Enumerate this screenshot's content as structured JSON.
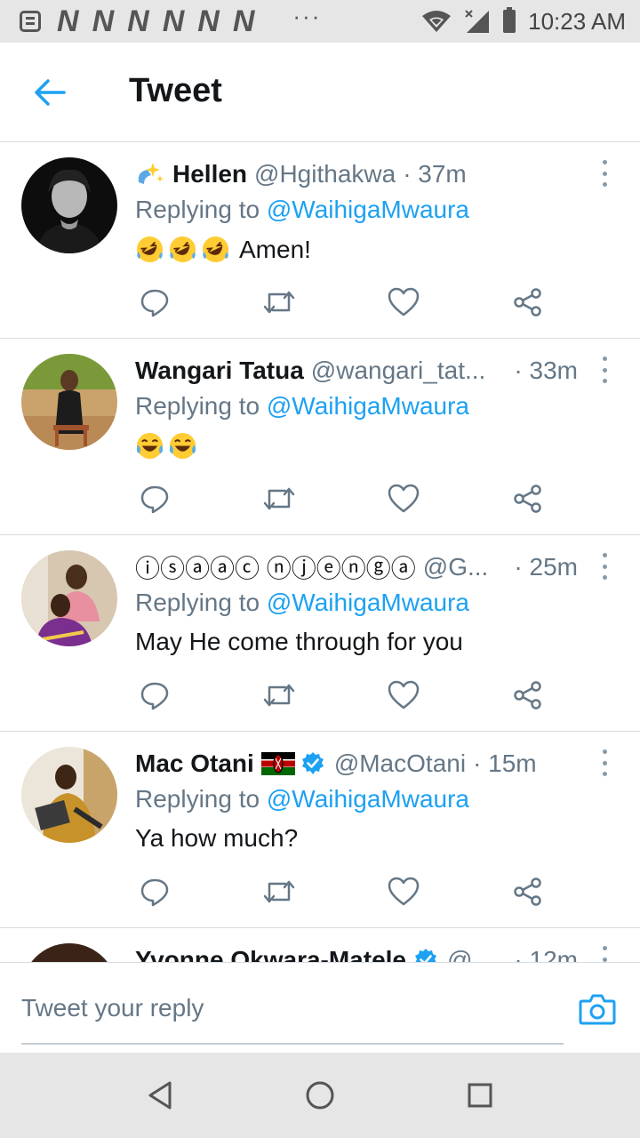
{
  "status_bar": {
    "notification_icons": [
      "N",
      "N",
      "N",
      "N",
      "N",
      "N"
    ],
    "overflow_dots": "···",
    "time": "10:23 AM"
  },
  "app_bar": {
    "title": "Tweet",
    "back_icon": "arrow-left-icon"
  },
  "tweets": [
    {
      "name_prefix_emoji": "sparkles-icon",
      "name": "Hellen",
      "handle": "@Hgithakwa",
      "time": "· 37m",
      "replying_prefix": "Replying to ",
      "replying_to": "@WaihigaMwaura",
      "body_emojis": [
        "rofl-emoji",
        "rofl-emoji",
        "rofl-emoji"
      ],
      "body_text": "Amen!"
    },
    {
      "name": "Wangari Tatua",
      "handle": "@wangari_tat...",
      "time": "· 33m",
      "replying_prefix": "Replying to ",
      "replying_to": "@WaihigaMwaura",
      "body_emojis": [
        "joy-emoji",
        "joy-emoji"
      ],
      "body_text": ""
    },
    {
      "name": "ⓘⓢⓐⓐⓒ ⓝⓙⓔⓝⓖⓐ",
      "handle": "@G...",
      "time": "· 25m",
      "replying_prefix": "Replying to ",
      "replying_to": "@WaihigaMwaura",
      "body_text": "May He come through for you"
    },
    {
      "name": "Mac Otani",
      "name_flag": "kenya-flag-icon",
      "verified": true,
      "handle": "@MacOtani",
      "time": "· 15m",
      "replying_prefix": "Replying to ",
      "replying_to": "@WaihigaMwaura",
      "body_text": "Ya how much?"
    },
    {
      "name": "Yvonne Okwara-Matele",
      "verified": true,
      "handle": "@...",
      "time": "· 12m"
    }
  ],
  "composer": {
    "placeholder": "Tweet your reply"
  },
  "colors": {
    "accent": "#1da1f2",
    "secondary_text": "#657786",
    "divider": "#d8dde1",
    "system_bar": "#e6e6e6"
  }
}
